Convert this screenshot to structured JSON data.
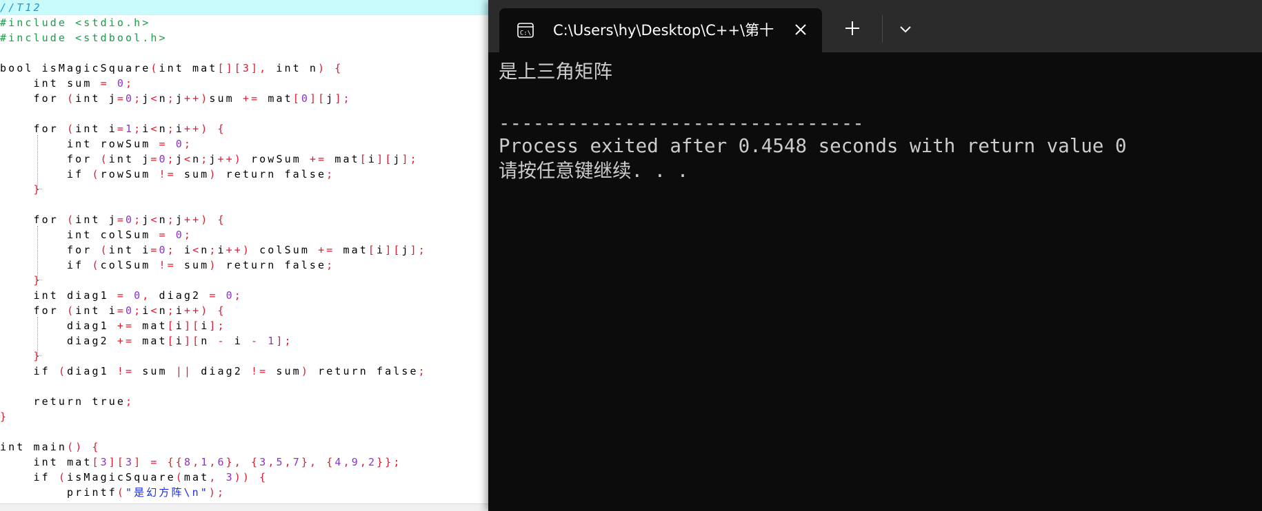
{
  "editor": {
    "lines": [
      [
        [
          "comment",
          "//T12"
        ]
      ],
      [
        [
          "pre",
          "#include <stdio.h>"
        ]
      ],
      [
        [
          "pre",
          "#include <stdbool.h>"
        ]
      ],
      [],
      [
        [
          "kw",
          "bool "
        ],
        [
          "id",
          "isMagicSquare"
        ],
        [
          "sym",
          "("
        ],
        [
          "kw",
          "int "
        ],
        [
          "id",
          "mat"
        ],
        [
          "sym",
          "[][3], "
        ],
        [
          "kw",
          "int "
        ],
        [
          "id",
          "n"
        ],
        [
          "sym",
          ") {"
        ]
      ],
      [
        [
          "id",
          "    "
        ],
        [
          "kw",
          "int "
        ],
        [
          "id",
          "sum "
        ],
        [
          "sym",
          "= "
        ],
        [
          "num",
          "0"
        ],
        [
          "sym",
          ";"
        ]
      ],
      [
        [
          "id",
          "    "
        ],
        [
          "kw",
          "for "
        ],
        [
          "sym",
          "("
        ],
        [
          "kw",
          "int "
        ],
        [
          "id",
          "j"
        ],
        [
          "sym",
          "="
        ],
        [
          "num",
          "0"
        ],
        [
          "sym",
          ";"
        ],
        [
          "id",
          "j"
        ],
        [
          "sym",
          "<"
        ],
        [
          "id",
          "n"
        ],
        [
          "sym",
          ";"
        ],
        [
          "id",
          "j"
        ],
        [
          "sym",
          "++)"
        ],
        [
          "id",
          "sum "
        ],
        [
          "sym",
          "+= "
        ],
        [
          "id",
          "mat"
        ],
        [
          "sym",
          "["
        ],
        [
          "num",
          "0"
        ],
        [
          "sym",
          "]["
        ],
        [
          "id",
          "j"
        ],
        [
          "sym",
          "];"
        ]
      ],
      [],
      [
        [
          "id",
          "    "
        ],
        [
          "kw",
          "for "
        ],
        [
          "sym",
          "("
        ],
        [
          "kw",
          "int "
        ],
        [
          "id",
          "i"
        ],
        [
          "sym",
          "="
        ],
        [
          "num",
          "1"
        ],
        [
          "sym",
          ";"
        ],
        [
          "id",
          "i"
        ],
        [
          "sym",
          "<"
        ],
        [
          "id",
          "n"
        ],
        [
          "sym",
          ";"
        ],
        [
          "id",
          "i"
        ],
        [
          "sym",
          "++) {"
        ]
      ],
      [
        [
          "id",
          "        "
        ],
        [
          "kw",
          "int "
        ],
        [
          "id",
          "rowSum "
        ],
        [
          "sym",
          "= "
        ],
        [
          "num",
          "0"
        ],
        [
          "sym",
          ";"
        ]
      ],
      [
        [
          "id",
          "        "
        ],
        [
          "kw",
          "for "
        ],
        [
          "sym",
          "("
        ],
        [
          "kw",
          "int "
        ],
        [
          "id",
          "j"
        ],
        [
          "sym",
          "="
        ],
        [
          "num",
          "0"
        ],
        [
          "sym",
          ";"
        ],
        [
          "id",
          "j"
        ],
        [
          "sym",
          "<"
        ],
        [
          "id",
          "n"
        ],
        [
          "sym",
          ";"
        ],
        [
          "id",
          "j"
        ],
        [
          "sym",
          "++) "
        ],
        [
          "id",
          "rowSum "
        ],
        [
          "sym",
          "+= "
        ],
        [
          "id",
          "mat"
        ],
        [
          "sym",
          "["
        ],
        [
          "id",
          "i"
        ],
        [
          "sym",
          "]["
        ],
        [
          "id",
          "j"
        ],
        [
          "sym",
          "];"
        ]
      ],
      [
        [
          "id",
          "        "
        ],
        [
          "kw",
          "if "
        ],
        [
          "sym",
          "("
        ],
        [
          "id",
          "rowSum "
        ],
        [
          "sym",
          "!= "
        ],
        [
          "id",
          "sum"
        ],
        [
          "sym",
          ") "
        ],
        [
          "kw",
          "return false"
        ],
        [
          "sym",
          ";"
        ]
      ],
      [
        [
          "id",
          "    "
        ],
        [
          "sym",
          "}"
        ]
      ],
      [],
      [
        [
          "id",
          "    "
        ],
        [
          "kw",
          "for "
        ],
        [
          "sym",
          "("
        ],
        [
          "kw",
          "int "
        ],
        [
          "id",
          "j"
        ],
        [
          "sym",
          "="
        ],
        [
          "num",
          "0"
        ],
        [
          "sym",
          ";"
        ],
        [
          "id",
          "j"
        ],
        [
          "sym",
          "<"
        ],
        [
          "id",
          "n"
        ],
        [
          "sym",
          ";"
        ],
        [
          "id",
          "j"
        ],
        [
          "sym",
          "++) {"
        ]
      ],
      [
        [
          "id",
          "        "
        ],
        [
          "kw",
          "int "
        ],
        [
          "id",
          "colSum "
        ],
        [
          "sym",
          "= "
        ],
        [
          "num",
          "0"
        ],
        [
          "sym",
          ";"
        ]
      ],
      [
        [
          "id",
          "        "
        ],
        [
          "kw",
          "for "
        ],
        [
          "sym",
          "("
        ],
        [
          "kw",
          "int "
        ],
        [
          "id",
          "i"
        ],
        [
          "sym",
          "="
        ],
        [
          "num",
          "0"
        ],
        [
          "sym",
          "; "
        ],
        [
          "id",
          "i"
        ],
        [
          "sym",
          "<"
        ],
        [
          "id",
          "n"
        ],
        [
          "sym",
          ";"
        ],
        [
          "id",
          "i"
        ],
        [
          "sym",
          "++) "
        ],
        [
          "id",
          "colSum "
        ],
        [
          "sym",
          "+= "
        ],
        [
          "id",
          "mat"
        ],
        [
          "sym",
          "["
        ],
        [
          "id",
          "i"
        ],
        [
          "sym",
          "]["
        ],
        [
          "id",
          "j"
        ],
        [
          "sym",
          "];"
        ]
      ],
      [
        [
          "id",
          "        "
        ],
        [
          "kw",
          "if "
        ],
        [
          "sym",
          "("
        ],
        [
          "id",
          "colSum "
        ],
        [
          "sym",
          "!= "
        ],
        [
          "id",
          "sum"
        ],
        [
          "sym",
          ") "
        ],
        [
          "kw",
          "return false"
        ],
        [
          "sym",
          ";"
        ]
      ],
      [
        [
          "id",
          "    "
        ],
        [
          "sym",
          "}"
        ]
      ],
      [
        [
          "id",
          "    "
        ],
        [
          "kw",
          "int "
        ],
        [
          "id",
          "diag1 "
        ],
        [
          "sym",
          "= "
        ],
        [
          "num",
          "0"
        ],
        [
          "sym",
          ", "
        ],
        [
          "id",
          "diag2 "
        ],
        [
          "sym",
          "= "
        ],
        [
          "num",
          "0"
        ],
        [
          "sym",
          ";"
        ]
      ],
      [
        [
          "id",
          "    "
        ],
        [
          "kw",
          "for "
        ],
        [
          "sym",
          "("
        ],
        [
          "kw",
          "int "
        ],
        [
          "id",
          "i"
        ],
        [
          "sym",
          "="
        ],
        [
          "num",
          "0"
        ],
        [
          "sym",
          ";"
        ],
        [
          "id",
          "i"
        ],
        [
          "sym",
          "<"
        ],
        [
          "id",
          "n"
        ],
        [
          "sym",
          ";"
        ],
        [
          "id",
          "i"
        ],
        [
          "sym",
          "++) {"
        ]
      ],
      [
        [
          "id",
          "        "
        ],
        [
          "id",
          "diag1 "
        ],
        [
          "sym",
          "+= "
        ],
        [
          "id",
          "mat"
        ],
        [
          "sym",
          "["
        ],
        [
          "id",
          "i"
        ],
        [
          "sym",
          "]["
        ],
        [
          "id",
          "i"
        ],
        [
          "sym",
          "];"
        ]
      ],
      [
        [
          "id",
          "        "
        ],
        [
          "id",
          "diag2 "
        ],
        [
          "sym",
          "+= "
        ],
        [
          "id",
          "mat"
        ],
        [
          "sym",
          "["
        ],
        [
          "id",
          "i"
        ],
        [
          "sym",
          "]["
        ],
        [
          "id",
          "n "
        ],
        [
          "sym",
          "- "
        ],
        [
          "id",
          "i "
        ],
        [
          "sym",
          "- "
        ],
        [
          "num",
          "1"
        ],
        [
          "sym",
          "];"
        ]
      ],
      [
        [
          "id",
          "    "
        ],
        [
          "sym",
          "}"
        ]
      ],
      [
        [
          "id",
          "    "
        ],
        [
          "kw",
          "if "
        ],
        [
          "sym",
          "("
        ],
        [
          "id",
          "diag1 "
        ],
        [
          "sym",
          "!= "
        ],
        [
          "id",
          "sum "
        ],
        [
          "sym",
          "|| "
        ],
        [
          "id",
          "diag2 "
        ],
        [
          "sym",
          "!= "
        ],
        [
          "id",
          "sum"
        ],
        [
          "sym",
          ") "
        ],
        [
          "kw",
          "return false"
        ],
        [
          "sym",
          ";"
        ]
      ],
      [],
      [
        [
          "id",
          "    "
        ],
        [
          "kw",
          "return true"
        ],
        [
          "sym",
          ";"
        ]
      ],
      [
        [
          "sym",
          "}"
        ]
      ],
      [],
      [
        [
          "kw",
          "int "
        ],
        [
          "id",
          "main"
        ],
        [
          "sym",
          "() {"
        ]
      ],
      [
        [
          "id",
          "    "
        ],
        [
          "kw",
          "int "
        ],
        [
          "id",
          "mat"
        ],
        [
          "sym",
          "["
        ],
        [
          "num",
          "3"
        ],
        [
          "sym",
          "]["
        ],
        [
          "num",
          "3"
        ],
        [
          "sym",
          "] = {{"
        ],
        [
          "num",
          "8"
        ],
        [
          "sym",
          ","
        ],
        [
          "num",
          "1"
        ],
        [
          "sym",
          ","
        ],
        [
          "num",
          "6"
        ],
        [
          "sym",
          "}, {"
        ],
        [
          "num",
          "3"
        ],
        [
          "sym",
          ","
        ],
        [
          "num",
          "5"
        ],
        [
          "sym",
          ","
        ],
        [
          "num",
          "7"
        ],
        [
          "sym",
          "}, {"
        ],
        [
          "num",
          "4"
        ],
        [
          "sym",
          ","
        ],
        [
          "num",
          "9"
        ],
        [
          "sym",
          ","
        ],
        [
          "num",
          "2"
        ],
        [
          "sym",
          "}};"
        ]
      ],
      [
        [
          "id",
          "    "
        ],
        [
          "kw",
          "if "
        ],
        [
          "sym",
          "("
        ],
        [
          "id",
          "isMagicSquare"
        ],
        [
          "sym",
          "("
        ],
        [
          "id",
          "mat"
        ],
        [
          "sym",
          ", "
        ],
        [
          "num",
          "3"
        ],
        [
          "sym",
          ")) {"
        ]
      ],
      [
        [
          "id",
          "        "
        ],
        [
          "id",
          "printf"
        ],
        [
          "sym",
          "("
        ],
        [
          "str",
          "\"是幻方阵\\n\""
        ],
        [
          "sym",
          ");"
        ]
      ]
    ]
  },
  "terminal": {
    "tab_title": "C:\\Users\\hy\\Desktop\\C++\\第十",
    "output": [
      "是上三角矩阵",
      "",
      "--------------------------------",
      "Process exited after 0.4548 seconds with return value 0",
      "请按任意键继续. . ."
    ]
  },
  "colors": {
    "terminal_bg": "#0c0c0c",
    "terminal_text": "#cccccc",
    "titlebar_bg": "#2b2b2b",
    "editor_highlight": "#c8fafc",
    "code_symbol": "#e0172c",
    "code_number": "#8f2fd1",
    "code_preprocessor": "#1d9a4a",
    "code_comment": "#1b9ad2"
  }
}
